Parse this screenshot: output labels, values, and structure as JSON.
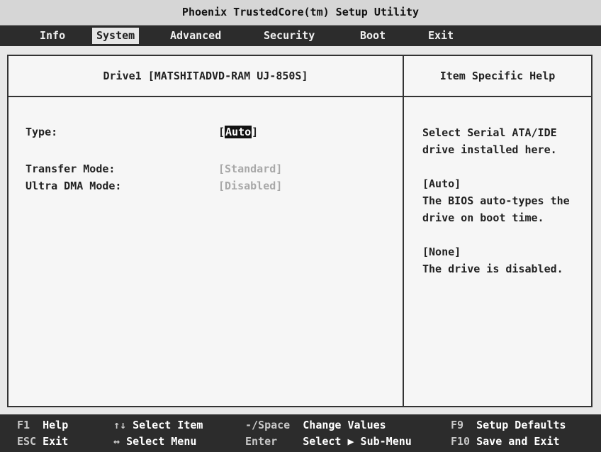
{
  "title": "Phoenix TrustedCore(tm) Setup Utility",
  "menu": {
    "items": [
      {
        "label": "Info"
      },
      {
        "label": "System"
      },
      {
        "label": "Advanced"
      },
      {
        "label": "Security"
      },
      {
        "label": "Boot"
      },
      {
        "label": "Exit"
      }
    ],
    "active": "System"
  },
  "panel": {
    "heading": "Drive1 [MATSHITADVD-RAM UJ-850S]",
    "fields": {
      "type": {
        "label": "Type:",
        "bracket_open": "[",
        "value": "Auto",
        "bracket_close": "]"
      },
      "transfer_mode": {
        "label": "Transfer Mode:",
        "value": "[Standard]"
      },
      "ultra_dma_mode": {
        "label": "Ultra DMA Mode:",
        "value": "[Disabled]"
      }
    }
  },
  "help": {
    "heading": "Item Specific Help",
    "lines": [
      "Select Serial ATA/IDE",
      "drive installed here.",
      "",
      "[Auto]",
      "The BIOS auto-types the",
      "drive on boot time.",
      "",
      "[None]",
      "The drive is disabled."
    ]
  },
  "footer": {
    "row1": [
      {
        "key": "F1",
        "desc": "Help"
      },
      {
        "key": "↑↓",
        "desc": "Select Item"
      },
      {
        "key": "-/Space",
        "desc": "Change Values"
      },
      {
        "key": "F9",
        "desc": "Setup Defaults"
      }
    ],
    "row2": [
      {
        "key": "ESC",
        "desc": "Exit"
      },
      {
        "key": "↔",
        "desc": "Select Menu"
      },
      {
        "key": "Enter",
        "desc": "Select ▶ Sub-Menu"
      },
      {
        "key": "F10",
        "desc": "Save and Exit"
      }
    ]
  },
  "colors": {
    "background": "#e8e8e8",
    "bar": "#2c2c2c",
    "dim_text": "#a8a8a8"
  }
}
